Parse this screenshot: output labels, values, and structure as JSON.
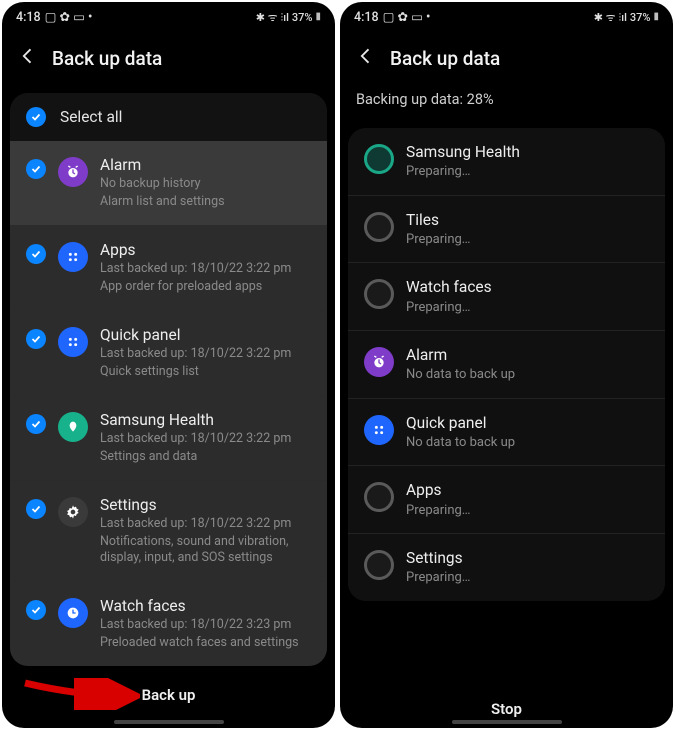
{
  "status": {
    "time": "4:18",
    "battery": "37%",
    "left_icons": "▢ ✿ ▭ •",
    "right_icons": "✱ ᯤ ⫶ıl"
  },
  "left": {
    "title": "Back up data",
    "select_all": "Select all",
    "items": [
      {
        "title": "Alarm",
        "sub1": "No backup history",
        "sub2": "Alarm list and settings",
        "icon": "alarm",
        "color": "ic-purple",
        "highlight": true
      },
      {
        "title": "Apps",
        "sub1": "Last backed up: 18/10/22 3:22 pm",
        "sub2": "App order for preloaded apps",
        "icon": "apps",
        "color": "ic-blue"
      },
      {
        "title": "Quick panel",
        "sub1": "Last backed up: 18/10/22 3:22 pm",
        "sub2": "Quick settings list",
        "icon": "grid",
        "color": "ic-blue"
      },
      {
        "title": "Samsung Health",
        "sub1": "Last backed up: 18/10/22 3:22 pm",
        "sub2": "Settings and data",
        "icon": "health",
        "color": "ic-teal"
      },
      {
        "title": "Settings",
        "sub1": "Last backed up: 18/10/22 3:22 pm",
        "sub2": "Notifications, sound and vibration, display, input, and SOS settings",
        "icon": "gear",
        "color": "ic-gray"
      },
      {
        "title": "Watch faces",
        "sub1": "Last backed up: 18/10/22 3:23 pm",
        "sub2": "Preloaded watch faces and settings",
        "icon": "clock",
        "color": "ic-blue"
      }
    ],
    "button": "Back up"
  },
  "right": {
    "title": "Back up data",
    "progress_label": "Backing up data: 28%",
    "items": [
      {
        "title": "Samsung Health",
        "sub": "Preparing…",
        "color": "ic-ring-teal"
      },
      {
        "title": "Tiles",
        "sub": "Preparing…",
        "color": "ic-ring"
      },
      {
        "title": "Watch faces",
        "sub": "Preparing…",
        "color": "ic-ring"
      },
      {
        "title": "Alarm",
        "sub": "No data to back up",
        "color": "ic-purple",
        "icon": "alarm"
      },
      {
        "title": "Quick panel",
        "sub": "No data to back up",
        "color": "ic-blue",
        "icon": "grid"
      },
      {
        "title": "Apps",
        "sub": "Preparing…",
        "color": "ic-ring"
      },
      {
        "title": "Settings",
        "sub": "Preparing…",
        "color": "ic-ring"
      }
    ],
    "button": "Stop"
  }
}
